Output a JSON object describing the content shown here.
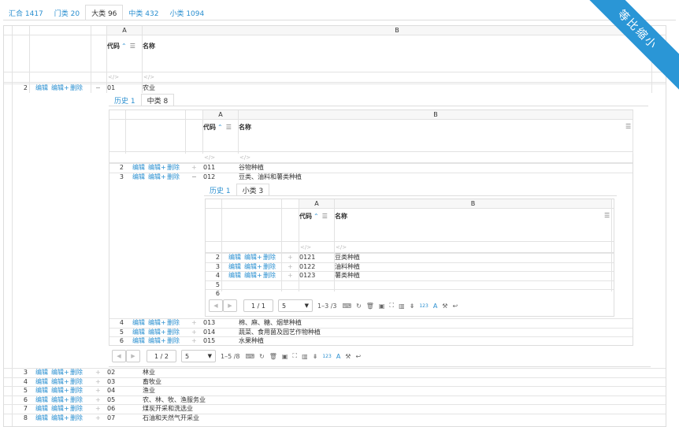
{
  "top_tabs": [
    {
      "label": "汇合 1417",
      "active": false
    },
    {
      "label": "门类 20",
      "active": false
    },
    {
      "label": "大类 96",
      "active": true
    },
    {
      "label": "中类 432",
      "active": false
    },
    {
      "label": "小类 1094",
      "active": false
    }
  ],
  "ribbon": "等比缩小",
  "links": {
    "edit": "编辑",
    "edit_plus": "编辑+",
    "delete": "删除"
  },
  "col_letters": {
    "a": "A",
    "b": "B"
  },
  "headers": {
    "code": "代码",
    "name": "名称",
    "sort": "⌃",
    "menu": "☰"
  },
  "filter_icon": "</>",
  "lvl1": {
    "first_row": {
      "num": "2",
      "toggle": "−",
      "code": "01",
      "name": "农业"
    },
    "sub_tabs": [
      {
        "label": "历史 1",
        "active": false
      },
      {
        "label": "中类 8",
        "active": true
      }
    ],
    "rows_after": [
      {
        "num": "3",
        "toggle": "+",
        "code": "02",
        "name": "林业"
      },
      {
        "num": "4",
        "toggle": "+",
        "code": "03",
        "name": "畜牧业"
      },
      {
        "num": "5",
        "toggle": "+",
        "code": "04",
        "name": "渔业"
      },
      {
        "num": "6",
        "toggle": "+",
        "code": "05",
        "name": "农、林、牧、渔服务业"
      },
      {
        "num": "7",
        "toggle": "+",
        "code": "06",
        "name": "煤炭开采和洗选业"
      },
      {
        "num": "8",
        "toggle": "+",
        "code": "07",
        "name": "石油和天然气开采业"
      }
    ]
  },
  "lvl2": {
    "rows_before": [
      {
        "num": "2",
        "toggle": "+",
        "code": "011",
        "name": "谷物种植"
      },
      {
        "num": "3",
        "toggle": "−",
        "code": "012",
        "name": "豆类、油料和薯类种植"
      }
    ],
    "sub_tabs": [
      {
        "label": "历史 1",
        "active": false
      },
      {
        "label": "小类 3",
        "active": true
      }
    ],
    "rows_after": [
      {
        "num": "4",
        "toggle": "+",
        "code": "013",
        "name": "棉、麻、糖、烟草种植"
      },
      {
        "num": "5",
        "toggle": "+",
        "code": "014",
        "name": "蔬菜、食用菌及园艺作物种植"
      },
      {
        "num": "6",
        "toggle": "+",
        "code": "015",
        "name": "水果种植"
      }
    ],
    "pager": {
      "page": "1 / 2",
      "size": "5",
      "range": "1–5 /8"
    }
  },
  "lvl3": {
    "rows": [
      {
        "num": "2",
        "toggle": "+",
        "code": "0121",
        "name": "豆类种植"
      },
      {
        "num": "3",
        "toggle": "+",
        "code": "0122",
        "name": "油料种植"
      },
      {
        "num": "4",
        "toggle": "+",
        "code": "0123",
        "name": "薯类种植"
      },
      {
        "num": "5",
        "toggle": "",
        "code": "",
        "name": ""
      },
      {
        "num": "6",
        "toggle": "",
        "code": "",
        "name": ""
      }
    ],
    "pager": {
      "page": "1 / 1",
      "size": "5",
      "range": "1–3 /3"
    }
  },
  "pager_icons": {
    "prev": "◀",
    "next": "▶",
    "caret": "▼",
    "keyboard": "⌨",
    "refresh": "↻",
    "trash": "🗑",
    "export": "▣",
    "crop": "⛶",
    "columns": "▥",
    "insert": "⇟",
    "numfmt": "123",
    "text": "A",
    "tools": "⚒",
    "wrap": "↩"
  }
}
